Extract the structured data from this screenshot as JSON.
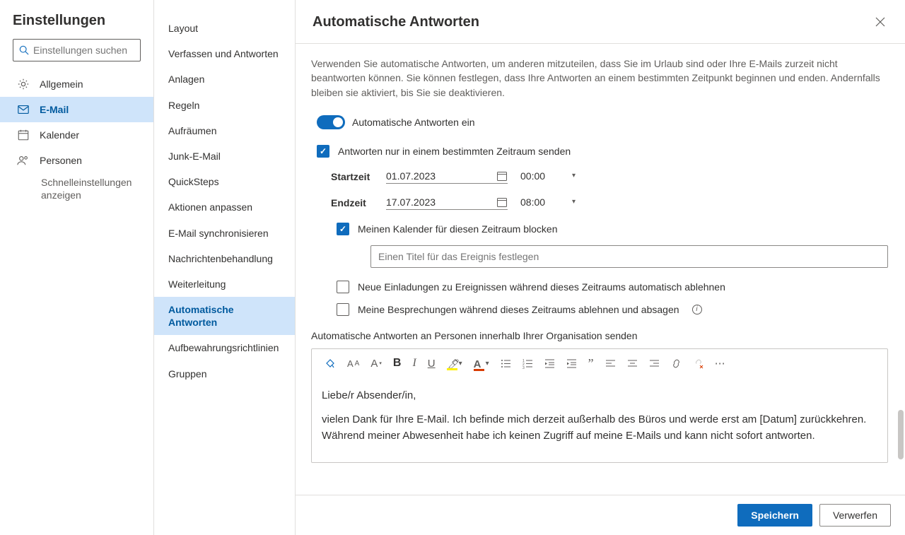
{
  "sidebar": {
    "title": "Einstellungen",
    "search_placeholder": "Einstellungen suchen",
    "items": [
      {
        "label": "Allgemein"
      },
      {
        "label": "E-Mail"
      },
      {
        "label": "Kalender"
      },
      {
        "label": "Personen"
      }
    ],
    "quick_link": "Schnelleinstellungen anzeigen"
  },
  "mid": {
    "items": [
      "Layout",
      "Verfassen und Antworten",
      "Anlagen",
      "Regeln",
      "Aufräumen",
      "Junk-E-Mail",
      "QuickSteps",
      "Aktionen anpassen",
      "E-Mail synchronisieren",
      "Nachrichtenbehandlung",
      "Weiterleitung",
      "Automatische Antworten",
      "Aufbewahrungsrichtlinien",
      "Gruppen"
    ]
  },
  "main": {
    "title": "Automatische Antworten",
    "intro": "Verwenden Sie automatische Antworten, um anderen mitzuteilen, dass Sie im Urlaub sind oder Ihre E-Mails zurzeit nicht beantworten können. Sie können festlegen, dass Ihre Antworten an einem bestimmten Zeitpunkt beginnen und enden. Andernfalls bleiben sie aktiviert, bis Sie sie deaktivieren.",
    "toggle_label": "Automatische Antworten ein",
    "period_label": "Antworten nur in einem bestimmten Zeitraum senden",
    "start_label": "Startzeit",
    "start_date": "01.07.2023",
    "start_time": "00:00",
    "end_label": "Endzeit",
    "end_date": "17.07.2023",
    "end_time": "08:00",
    "block_cal_label": "Meinen Kalender für diesen Zeitraum blocken",
    "event_title_placeholder": "Einen Titel für das Ereignis festlegen",
    "decline_new_label": "Neue Einladungen zu Ereignissen während dieses Zeitraums automatisch ablehnen",
    "cancel_meetings_label": "Meine Besprechungen während dieses Zeitraums ablehnen und absagen",
    "org_label": "Automatische Antworten an Personen innerhalb Ihrer Organisation senden",
    "editor_p1": "Liebe/r Absender/in,",
    "editor_p2": "vielen Dank für Ihre E-Mail. Ich befinde mich derzeit außerhalb des Büros und werde erst am [Datum] zurückkehren. Während meiner Abwesenheit habe ich keinen Zugriff auf meine E-Mails und kann nicht sofort antworten."
  },
  "footer": {
    "save": "Speichern",
    "discard": "Verwerfen"
  }
}
